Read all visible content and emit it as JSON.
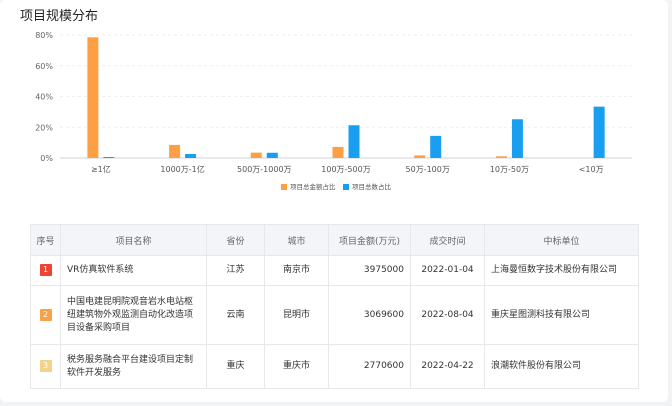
{
  "page_title": "项目规模分布",
  "chart_data": {
    "type": "bar",
    "categories": [
      "≥1亿",
      "1000万-1亿",
      "500万-1000万",
      "100万-500万",
      "50万-100万",
      "10万-50万",
      "<10万"
    ],
    "series": [
      {
        "name": "项目总金额占比",
        "color": "#ff9f43",
        "values": [
          78.5,
          8.5,
          3.5,
          7.2,
          1.7,
          1.1,
          0
        ]
      },
      {
        "name": "项目总数占比",
        "color": "#1a9ff0",
        "values": [
          0.3,
          2.6,
          3.4,
          21.3,
          14.4,
          25.2,
          33.4
        ]
      }
    ],
    "yticks": [
      "0%",
      "20%",
      "40%",
      "60%",
      "80%"
    ],
    "ylim": [
      0,
      80
    ],
    "legend_position": "bottom-center",
    "grid": true
  },
  "table": {
    "headers": [
      "序号",
      "项目名称",
      "省份",
      "城市",
      "项目金额(万元)",
      "成交时间",
      "中标单位"
    ],
    "rows": [
      {
        "rank": "1",
        "rank_color": "#ee4433",
        "name": "VR仿真软件系统",
        "province": "江苏",
        "city": "南京市",
        "amount": "3975000",
        "date": "2022-01-04",
        "winner": "上海曼恒数字技术股份有限公司"
      },
      {
        "rank": "2",
        "rank_color": "#f7a24b",
        "name": "中国电建昆明院观音岩水电站枢纽建筑物外观监测自动化改造项目设备采购项目",
        "province": "云南",
        "city": "昆明市",
        "amount": "3069600",
        "date": "2022-08-04",
        "winner": "重庆星图测科技有限公司"
      },
      {
        "rank": "3",
        "rank_color": "#f3d38a",
        "name": "税务服务融合平台建设项目定制软件开发服务",
        "province": "重庆",
        "city": "重庆市",
        "amount": "2770600",
        "date": "2022-04-22",
        "winner": "浪潮软件股份有限公司"
      }
    ]
  }
}
